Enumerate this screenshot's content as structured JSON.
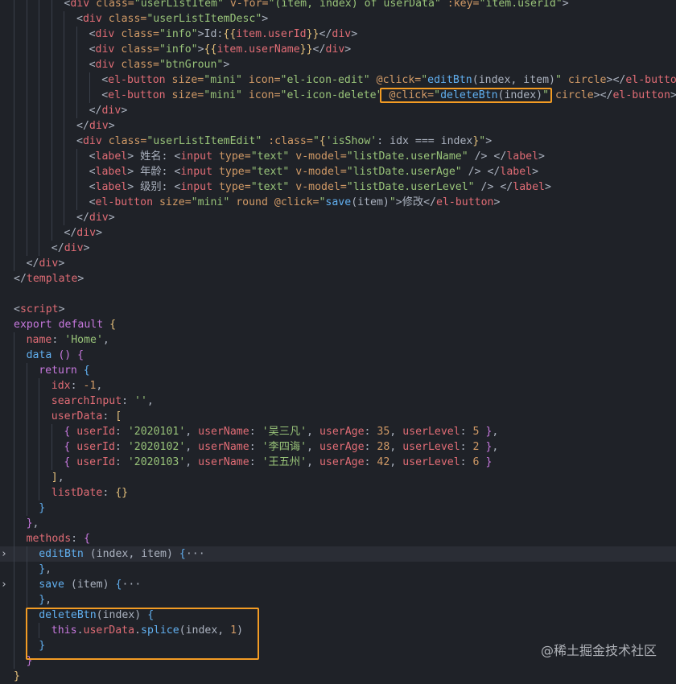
{
  "colors": {
    "tag": "#e06c75",
    "attr": "#d19a66",
    "string": "#98c379",
    "text": "#abb2bf",
    "punct": "#abb2bf",
    "keyword": "#c678dd",
    "func": "#61afef",
    "number": "#d19a66",
    "prop": "#e06c75",
    "bracket_y": "#e5c07b",
    "bracket_p": "#c678dd",
    "bracket_b": "#61afef",
    "fold": "#7f848e",
    "highlight_box": "#f39c24"
  },
  "watermark": "@稀土掘金技术社区",
  "lines": [
    {
      "indent": 5,
      "tokens": [
        [
          "<",
          "punct"
        ],
        [
          "div",
          "tag"
        ],
        [
          " class=",
          "attr"
        ],
        [
          "\"userListItem\"",
          "string"
        ],
        [
          " v-for=",
          "attr"
        ],
        [
          "\"(item, index) of userData\"",
          "string"
        ],
        [
          " :key=",
          "attr"
        ],
        [
          "\"item.userId\"",
          "string"
        ],
        [
          ">",
          "punct"
        ]
      ]
    },
    {
      "indent": 6,
      "tokens": [
        [
          "<",
          "punct"
        ],
        [
          "div",
          "tag"
        ],
        [
          " class=",
          "attr"
        ],
        [
          "\"userListItemDesc\"",
          "string"
        ],
        [
          ">",
          "punct"
        ]
      ]
    },
    {
      "indent": 7,
      "tokens": [
        [
          "<",
          "punct"
        ],
        [
          "div",
          "tag"
        ],
        [
          " class=",
          "attr"
        ],
        [
          "\"info\"",
          "string"
        ],
        [
          ">",
          "punct"
        ],
        [
          "Id:",
          "text"
        ],
        [
          "{{",
          "bracket_y"
        ],
        [
          "item.userId",
          "prop"
        ],
        [
          "}}",
          "bracket_y"
        ],
        [
          "</",
          "punct"
        ],
        [
          "div",
          "tag"
        ],
        [
          ">",
          "punct"
        ]
      ]
    },
    {
      "indent": 7,
      "tokens": [
        [
          "<",
          "punct"
        ],
        [
          "div",
          "tag"
        ],
        [
          " class=",
          "attr"
        ],
        [
          "\"info\"",
          "string"
        ],
        [
          ">",
          "punct"
        ],
        [
          "{{",
          "bracket_y"
        ],
        [
          "item.userName",
          "prop"
        ],
        [
          "}}",
          "bracket_y"
        ],
        [
          "</",
          "punct"
        ],
        [
          "div",
          "tag"
        ],
        [
          ">",
          "punct"
        ]
      ]
    },
    {
      "indent": 7,
      "tokens": [
        [
          "<",
          "punct"
        ],
        [
          "div",
          "tag"
        ],
        [
          " class=",
          "attr"
        ],
        [
          "\"btnGroun\"",
          "string"
        ],
        [
          ">",
          "punct"
        ]
      ]
    },
    {
      "indent": 8,
      "tokens": [
        [
          "<",
          "punct"
        ],
        [
          "el-button",
          "tag"
        ],
        [
          " size=",
          "attr"
        ],
        [
          "\"mini\"",
          "string"
        ],
        [
          " icon=",
          "attr"
        ],
        [
          "\"el-icon-edit\"",
          "string"
        ],
        [
          " @click=",
          "attr"
        ],
        [
          "\"",
          "string"
        ],
        [
          "editBtn",
          "func"
        ],
        [
          "(index, item)",
          "text"
        ],
        [
          "\"",
          "string"
        ],
        [
          " circle",
          "attr"
        ],
        [
          "></",
          "punct"
        ],
        [
          "el-button",
          "tag"
        ],
        [
          ">",
          "punct"
        ]
      ]
    },
    {
      "indent": 8,
      "tokens": [
        [
          "<",
          "punct"
        ],
        [
          "el-button",
          "tag"
        ],
        [
          " size=",
          "attr"
        ],
        [
          "\"mini\"",
          "string"
        ],
        [
          " icon=",
          "attr"
        ],
        [
          "\"el-icon-delete\"",
          "string"
        ],
        [
          " @click=",
          "attr"
        ],
        [
          "\"",
          "string"
        ],
        [
          "deleteBtn",
          "func"
        ],
        [
          "(index)",
          "text"
        ],
        [
          "\"",
          "string"
        ],
        [
          " circle",
          "attr"
        ],
        [
          "></",
          "punct"
        ],
        [
          "el-button",
          "tag"
        ],
        [
          ">",
          "punct"
        ]
      ]
    },
    {
      "indent": 7,
      "tokens": [
        [
          "</",
          "punct"
        ],
        [
          "div",
          "tag"
        ],
        [
          ">",
          "punct"
        ]
      ]
    },
    {
      "indent": 6,
      "tokens": [
        [
          "</",
          "punct"
        ],
        [
          "div",
          "tag"
        ],
        [
          ">",
          "punct"
        ]
      ]
    },
    {
      "indent": 6,
      "tokens": [
        [
          "<",
          "punct"
        ],
        [
          "div",
          "tag"
        ],
        [
          " class=",
          "attr"
        ],
        [
          "\"userListItemEdit\"",
          "string"
        ],
        [
          " :class=",
          "attr"
        ],
        [
          "\"",
          "string"
        ],
        [
          "{",
          "bracket_y"
        ],
        [
          "'isShow'",
          "string"
        ],
        [
          ": idx === index",
          "text"
        ],
        [
          "}",
          "bracket_y"
        ],
        [
          "\"",
          "string"
        ],
        [
          ">",
          "punct"
        ]
      ]
    },
    {
      "indent": 7,
      "tokens": [
        [
          "<",
          "punct"
        ],
        [
          "label",
          "tag"
        ],
        [
          "> 姓名: ",
          "text"
        ],
        [
          "<",
          "punct"
        ],
        [
          "input",
          "tag"
        ],
        [
          " type=",
          "attr"
        ],
        [
          "\"text\"",
          "string"
        ],
        [
          " v-model=",
          "attr"
        ],
        [
          "\"listDate.userName\"",
          "string"
        ],
        [
          " /> ",
          "punct"
        ],
        [
          "</",
          "punct"
        ],
        [
          "label",
          "tag"
        ],
        [
          ">",
          "punct"
        ]
      ]
    },
    {
      "indent": 7,
      "tokens": [
        [
          "<",
          "punct"
        ],
        [
          "label",
          "tag"
        ],
        [
          "> 年龄: ",
          "text"
        ],
        [
          "<",
          "punct"
        ],
        [
          "input",
          "tag"
        ],
        [
          " type=",
          "attr"
        ],
        [
          "\"text\"",
          "string"
        ],
        [
          " v-model=",
          "attr"
        ],
        [
          "\"listDate.userAge\"",
          "string"
        ],
        [
          " /> ",
          "punct"
        ],
        [
          "</",
          "punct"
        ],
        [
          "label",
          "tag"
        ],
        [
          ">",
          "punct"
        ]
      ]
    },
    {
      "indent": 7,
      "tokens": [
        [
          "<",
          "punct"
        ],
        [
          "label",
          "tag"
        ],
        [
          "> 级别: ",
          "text"
        ],
        [
          "<",
          "punct"
        ],
        [
          "input",
          "tag"
        ],
        [
          " type=",
          "attr"
        ],
        [
          "\"text\"",
          "string"
        ],
        [
          " v-model=",
          "attr"
        ],
        [
          "\"listDate.userLevel\"",
          "string"
        ],
        [
          " /> ",
          "punct"
        ],
        [
          "</",
          "punct"
        ],
        [
          "label",
          "tag"
        ],
        [
          ">",
          "punct"
        ]
      ]
    },
    {
      "indent": 7,
      "tokens": [
        [
          "<",
          "punct"
        ],
        [
          "el-button",
          "tag"
        ],
        [
          " size=",
          "attr"
        ],
        [
          "\"mini\"",
          "string"
        ],
        [
          " round",
          "attr"
        ],
        [
          " @click=",
          "attr"
        ],
        [
          "\"",
          "string"
        ],
        [
          "save",
          "func"
        ],
        [
          "(item)",
          "text"
        ],
        [
          "\"",
          "string"
        ],
        [
          ">",
          "punct"
        ],
        [
          "修改",
          "text"
        ],
        [
          "</",
          "punct"
        ],
        [
          "el-button",
          "tag"
        ],
        [
          ">",
          "punct"
        ]
      ]
    },
    {
      "indent": 6,
      "tokens": [
        [
          "</",
          "punct"
        ],
        [
          "div",
          "tag"
        ],
        [
          ">",
          "punct"
        ]
      ]
    },
    {
      "indent": 5,
      "tokens": [
        [
          "</",
          "punct"
        ],
        [
          "div",
          "tag"
        ],
        [
          ">",
          "punct"
        ]
      ]
    },
    {
      "indent": 4,
      "tokens": [
        [
          "</",
          "punct"
        ],
        [
          "div",
          "tag"
        ],
        [
          ">",
          "punct"
        ]
      ]
    },
    {
      "indent": 2,
      "tokens": [
        [
          "</",
          "punct"
        ],
        [
          "div",
          "tag"
        ],
        [
          ">",
          "punct"
        ]
      ]
    },
    {
      "indent": 1,
      "tokens": [
        [
          "</",
          "punct"
        ],
        [
          "template",
          "tag"
        ],
        [
          ">",
          "punct"
        ]
      ]
    },
    {
      "indent": 1,
      "tokens": []
    },
    {
      "indent": 1,
      "tokens": [
        [
          "<",
          "punct"
        ],
        [
          "script",
          "tag"
        ],
        [
          ">",
          "punct"
        ]
      ]
    },
    {
      "indent": 1,
      "tokens": [
        [
          "export default ",
          "keyword"
        ],
        [
          "{",
          "bracket_y"
        ]
      ]
    },
    {
      "indent": 2,
      "tokens": [
        [
          "name",
          "prop"
        ],
        [
          ": ",
          "text"
        ],
        [
          "'Home'",
          "string"
        ],
        [
          ",",
          "text"
        ]
      ]
    },
    {
      "indent": 2,
      "tokens": [
        [
          "data",
          "func"
        ],
        [
          " ",
          "text"
        ],
        [
          "()",
          "bracket_p"
        ],
        [
          " ",
          "text"
        ],
        [
          "{",
          "bracket_p"
        ]
      ]
    },
    {
      "indent": 3,
      "tokens": [
        [
          "return ",
          "keyword"
        ],
        [
          "{",
          "bracket_b"
        ]
      ]
    },
    {
      "indent": 4,
      "tokens": [
        [
          "idx",
          "prop"
        ],
        [
          ": ",
          "text"
        ],
        [
          "-1",
          "number"
        ],
        [
          ",",
          "text"
        ]
      ]
    },
    {
      "indent": 4,
      "tokens": [
        [
          "searchInput",
          "prop"
        ],
        [
          ": ",
          "text"
        ],
        [
          "''",
          "string"
        ],
        [
          ",",
          "text"
        ]
      ]
    },
    {
      "indent": 4,
      "tokens": [
        [
          "userData",
          "prop"
        ],
        [
          ": ",
          "text"
        ],
        [
          "[",
          "bracket_y"
        ]
      ]
    },
    {
      "indent": 5,
      "tokens": [
        [
          "{ ",
          "bracket_p"
        ],
        [
          "userId",
          "prop"
        ],
        [
          ": ",
          "text"
        ],
        [
          "'2020101'",
          "string"
        ],
        [
          ", ",
          "text"
        ],
        [
          "userName",
          "prop"
        ],
        [
          ": ",
          "text"
        ],
        [
          "'吴三凡'",
          "string"
        ],
        [
          ", ",
          "text"
        ],
        [
          "userAge",
          "prop"
        ],
        [
          ": ",
          "text"
        ],
        [
          "35",
          "number"
        ],
        [
          ", ",
          "text"
        ],
        [
          "userLevel",
          "prop"
        ],
        [
          ": ",
          "text"
        ],
        [
          "5",
          "number"
        ],
        [
          " }",
          "bracket_p"
        ],
        [
          ",",
          "text"
        ]
      ]
    },
    {
      "indent": 5,
      "tokens": [
        [
          "{ ",
          "bracket_p"
        ],
        [
          "userId",
          "prop"
        ],
        [
          ": ",
          "text"
        ],
        [
          "'2020102'",
          "string"
        ],
        [
          ", ",
          "text"
        ],
        [
          "userName",
          "prop"
        ],
        [
          ": ",
          "text"
        ],
        [
          "'李四诲'",
          "string"
        ],
        [
          ", ",
          "text"
        ],
        [
          "userAge",
          "prop"
        ],
        [
          ": ",
          "text"
        ],
        [
          "28",
          "number"
        ],
        [
          ", ",
          "text"
        ],
        [
          "userLevel",
          "prop"
        ],
        [
          ": ",
          "text"
        ],
        [
          "2",
          "number"
        ],
        [
          " }",
          "bracket_p"
        ],
        [
          ",",
          "text"
        ]
      ]
    },
    {
      "indent": 5,
      "tokens": [
        [
          "{ ",
          "bracket_p"
        ],
        [
          "userId",
          "prop"
        ],
        [
          ": ",
          "text"
        ],
        [
          "'2020103'",
          "string"
        ],
        [
          ", ",
          "text"
        ],
        [
          "userName",
          "prop"
        ],
        [
          ": ",
          "text"
        ],
        [
          "'王五州'",
          "string"
        ],
        [
          ", ",
          "text"
        ],
        [
          "userAge",
          "prop"
        ],
        [
          ": ",
          "text"
        ],
        [
          "42",
          "number"
        ],
        [
          ", ",
          "text"
        ],
        [
          "userLevel",
          "prop"
        ],
        [
          ": ",
          "text"
        ],
        [
          "6",
          "number"
        ],
        [
          " }",
          "bracket_p"
        ]
      ]
    },
    {
      "indent": 4,
      "tokens": [
        [
          "]",
          "bracket_y"
        ],
        [
          ",",
          "text"
        ]
      ]
    },
    {
      "indent": 4,
      "tokens": [
        [
          "listDate",
          "prop"
        ],
        [
          ": ",
          "text"
        ],
        [
          "{}",
          "bracket_y"
        ]
      ]
    },
    {
      "indent": 3,
      "tokens": [
        [
          "}",
          "bracket_b"
        ]
      ]
    },
    {
      "indent": 2,
      "tokens": [
        [
          "}",
          "bracket_p"
        ],
        [
          ",",
          "text"
        ]
      ]
    },
    {
      "indent": 2,
      "tokens": [
        [
          "methods",
          "prop"
        ],
        [
          ": ",
          "text"
        ],
        [
          "{",
          "bracket_p"
        ]
      ]
    },
    {
      "indent": 3,
      "fold": true,
      "highlight": true,
      "tokens": [
        [
          "editBtn",
          "func"
        ],
        [
          " (index, item) ",
          "text"
        ],
        [
          "{",
          "bracket_b"
        ],
        [
          "···",
          "text"
        ]
      ]
    },
    {
      "indent": 3,
      "tokens": [
        [
          "}",
          "bracket_b"
        ],
        [
          ",",
          "text"
        ]
      ]
    },
    {
      "indent": 3,
      "fold": true,
      "tokens": [
        [
          "save",
          "func"
        ],
        [
          " (item) ",
          "text"
        ],
        [
          "{",
          "bracket_b"
        ],
        [
          "···",
          "text"
        ]
      ]
    },
    {
      "indent": 3,
      "tokens": [
        [
          "}",
          "bracket_b"
        ],
        [
          ",",
          "text"
        ]
      ]
    },
    {
      "indent": 3,
      "tokens": [
        [
          "deleteBtn",
          "func"
        ],
        [
          "(index) ",
          "text"
        ],
        [
          "{",
          "bracket_b"
        ]
      ]
    },
    {
      "indent": 4,
      "tokens": [
        [
          "this",
          "keyword"
        ],
        [
          ".",
          "text"
        ],
        [
          "userData",
          "prop"
        ],
        [
          ".",
          "text"
        ],
        [
          "splice",
          "func"
        ],
        [
          "(index, ",
          "text"
        ],
        [
          "1",
          "number"
        ],
        [
          ")",
          "text"
        ]
      ]
    },
    {
      "indent": 3,
      "tokens": [
        [
          "}",
          "bracket_b"
        ]
      ]
    },
    {
      "indent": 2,
      "tokens": [
        [
          "}",
          "bracket_p"
        ]
      ]
    },
    {
      "indent": 1,
      "tokens": [
        [
          "}",
          "bracket_y"
        ]
      ]
    }
  ]
}
